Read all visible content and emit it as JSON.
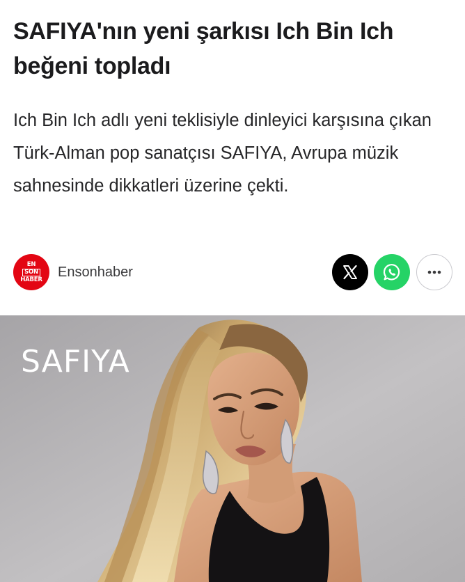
{
  "article": {
    "headline": "SAFIYA'nın yeni şarkısı Ich Bin Ich beğeni topladı",
    "summary": "Ich Bin Ich adlı yeni teklisiyle dinleyici karşısına çıkan Türk-Alman pop sanatçısı SAFIYA, Avrupa müzik sahnesinde dikkatleri üzerine çekti."
  },
  "source": {
    "name": "Ensonhaber",
    "logo_lines": [
      "EN",
      "SON",
      "HABER"
    ],
    "logo_color": "#e30613"
  },
  "share": {
    "x_icon": "x-logo-icon",
    "whatsapp_icon": "whatsapp-icon",
    "more_icon": "more-horizontal-icon",
    "x_color": "#000000",
    "whatsapp_color": "#25d366"
  },
  "hero": {
    "caption": "SAFIYA",
    "image_subject": "photo-of-woman-with-long-blonde-hair"
  }
}
